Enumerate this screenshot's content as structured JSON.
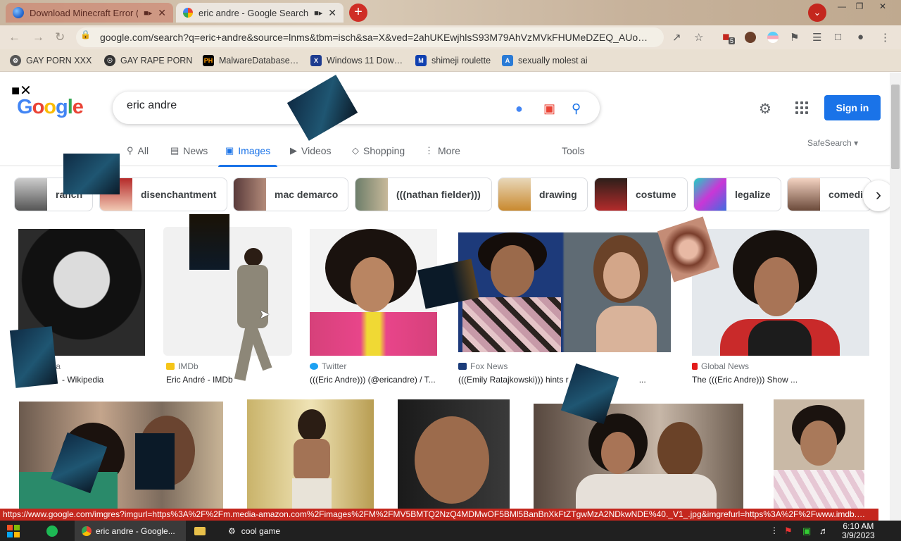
{
  "browser": {
    "tabs": [
      {
        "title": "Download Minecraft Error (",
        "active": false
      },
      {
        "title": "eric andre - Google Search",
        "active": true
      }
    ],
    "url": "google.com/search?q=eric+andre&source=lnms&tbm=isch&sa=X&ved=2ahUKEwjhlsS93M79AhVzMVkFHUMeDZEQ_AUo…",
    "extension_badge": "5",
    "bookmarks": [
      {
        "label": "GAY PORN XXX"
      },
      {
        "label": "GAY RAPE PORN"
      },
      {
        "label": "MalwareDatabase…"
      },
      {
        "label": "Windows 11 Dow…"
      },
      {
        "label": "shimeji roulette"
      },
      {
        "label": "sexually molest ai"
      }
    ],
    "status_url": "https://www.google.com/imgres?imgurl=https%3A%2F%2Fm.media-amazon.com%2Fimages%2FM%2FMV5BMTQ2NzQ4MDMwOF5BMl5BanBnXkFtZTgwMzA2NDkwNDE%40._V1_.jpg&imgrefurl=https%3A%2F%2Fwww.imdb.…"
  },
  "google": {
    "logo": [
      "G",
      "o",
      "o",
      "g",
      "l",
      "e"
    ],
    "query": "eric andre",
    "signin_label": "Sign in",
    "tabs": [
      {
        "label": "All",
        "icon": "search-icon"
      },
      {
        "label": "News",
        "icon": "news-icon"
      },
      {
        "label": "Images",
        "icon": "image-icon"
      },
      {
        "label": "Videos",
        "icon": "video-icon"
      },
      {
        "label": "Shopping",
        "icon": "tag-icon"
      },
      {
        "label": "More",
        "icon": "more-icon"
      }
    ],
    "tools_label": "Tools",
    "safesearch_label": "SafeSearch",
    "chips": [
      {
        "label": "ranch"
      },
      {
        "label": "disenchantment"
      },
      {
        "label": "mac demarco"
      },
      {
        "label": "(((nathan fielder)))"
      },
      {
        "label": "drawing"
      },
      {
        "label": "costume"
      },
      {
        "label": "legalize"
      },
      {
        "label": "comedia"
      }
    ],
    "results": [
      {
        "source": "dia",
        "title": "- Wikipedia"
      },
      {
        "source": "IMDb",
        "title": "Eric André - IMDb"
      },
      {
        "source": "Twitter",
        "title": "(((Eric Andre))) (@ericandre) / T..."
      },
      {
        "source": "Fox News",
        "title": "(((Emily Ratajkowski))) hints r"
      },
      {
        "source": "Global News",
        "title": "The (((Eric Andre))) Show ..."
      }
    ],
    "results_title_suffix": "..."
  },
  "taskbar": {
    "items": [
      {
        "label": "eric andre - Google..."
      },
      {
        "label": "cool game"
      }
    ],
    "time": "6:10 AM",
    "date": "3/9/2023"
  },
  "colors": {
    "google_blue": "#1a73e8",
    "accent_red": "#c4271e"
  }
}
